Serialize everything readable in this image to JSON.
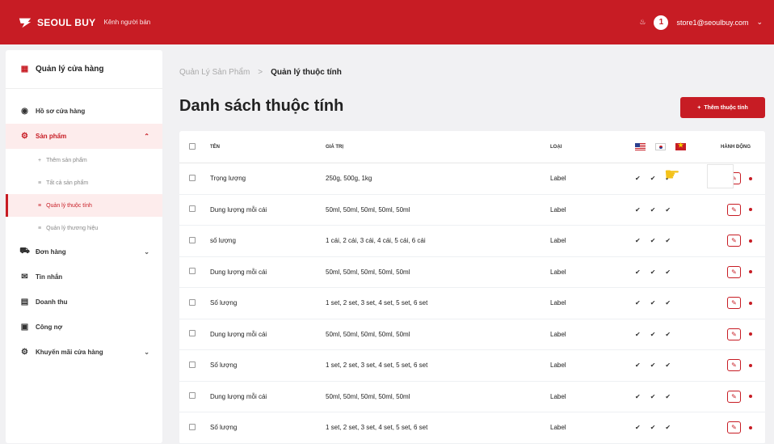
{
  "header": {
    "brand": "SEOUL BUY",
    "subtitle": "Kênh người bán",
    "user_email": "store1@seoulbuy.com"
  },
  "sidebar": {
    "title": "Quản lý cửa hàng",
    "items": [
      {
        "label": "Hồ sơ cửa hàng",
        "icon": "store-profile-icon"
      },
      {
        "label": "Sản phẩm",
        "icon": "product-icon"
      },
      {
        "label": "Đơn hàng",
        "icon": "cart-icon"
      },
      {
        "label": "Tin nhắn",
        "icon": "message-icon"
      },
      {
        "label": "Doanh thu",
        "icon": "revenue-icon"
      },
      {
        "label": "Công nợ",
        "icon": "debt-icon"
      },
      {
        "label": "Khuyến mãi cửa hàng",
        "icon": "promotion-icon"
      }
    ],
    "product_sub": [
      {
        "label": "Thêm sản phẩm"
      },
      {
        "label": "Tất cả sản phẩm"
      },
      {
        "label": "Quản lý thuộc tính"
      },
      {
        "label": "Quản lý thương hiệu"
      }
    ]
  },
  "breadcrumb": {
    "level1": "Quản Lý Sản Phẩm",
    "separator": ">",
    "level2": "Quản lý thuộc tính"
  },
  "page_title": "Danh sách thuộc tính",
  "add_button": "Thêm thuộc tính",
  "table": {
    "columns": {
      "name": "TÊN",
      "value": "GIÁ TRỊ",
      "type": "LOẠI",
      "actions": "HÀNH ĐỘNG"
    },
    "rows": [
      {
        "name": "Trọng lượng",
        "value": "250g, 500g, 1kg",
        "type": "Label"
      },
      {
        "name": "Dung lượng mỗi cái",
        "value": "50ml, 50ml, 50ml, 50ml, 50ml",
        "type": "Label"
      },
      {
        "name": "số lượng",
        "value": "1 cái, 2 cái, 3 cái, 4 cái, 5 cái, 6 cái",
        "type": "Label"
      },
      {
        "name": "Dung lượng mỗi cái",
        "value": "50ml, 50ml, 50ml, 50ml, 50ml",
        "type": "Label"
      },
      {
        "name": "Số lượng",
        "value": "1 set, 2 set, 3 set, 4 set, 5 set, 6 set",
        "type": "Label"
      },
      {
        "name": "Dung lượng mỗi cái",
        "value": "50ml, 50ml, 50ml, 50ml, 50ml",
        "type": "Label"
      },
      {
        "name": "Số lượng",
        "value": "1 set, 2 set, 3 set, 4 set, 5 set, 6 set",
        "type": "Label"
      },
      {
        "name": "Dung lượng mỗi cái",
        "value": "50ml, 50ml, 50ml, 50ml, 50ml",
        "type": "Label"
      },
      {
        "name": "Số lượng",
        "value": "1 set, 2 set, 3 set, 4 set, 5 set, 6 set",
        "type": "Label"
      }
    ]
  },
  "colors": {
    "brand_red": "#c71c24",
    "background": "#f1f1f3"
  }
}
